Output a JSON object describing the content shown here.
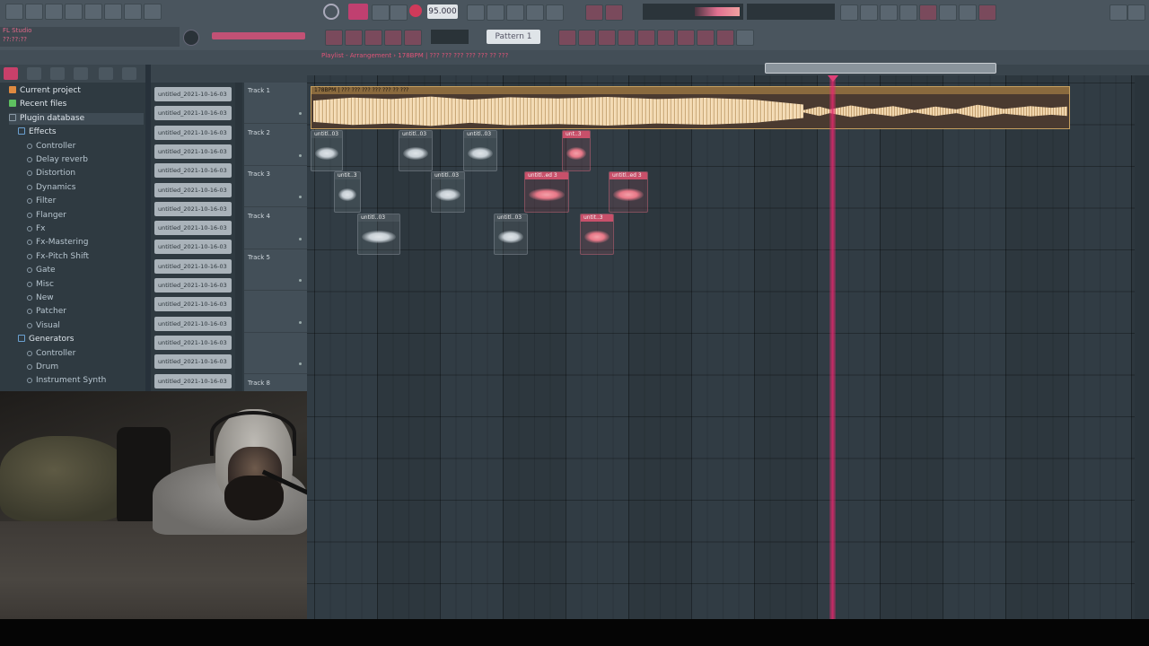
{
  "app": {
    "name": "FL Studio",
    "time": "??:??:??"
  },
  "toolbar": {
    "tempo": "95.000",
    "pattern": "Pattern 1"
  },
  "playlist": {
    "title": "Playlist - Arrangement › 178BPM | ??? ??? ??? ??? ??? ?? ???"
  },
  "browser": {
    "items": [
      {
        "label": "Current project",
        "icon": "folder-icon",
        "level": 0
      },
      {
        "label": "Recent files",
        "icon": "folder-icon",
        "level": 0
      },
      {
        "label": "Plugin database",
        "icon": "database-icon",
        "level": 0
      },
      {
        "label": "Effects",
        "icon": "folder-icon",
        "level": 1
      },
      {
        "label": "Controller",
        "icon": "plugin-icon",
        "level": 2
      },
      {
        "label": "Delay reverb",
        "icon": "plugin-icon",
        "level": 2
      },
      {
        "label": "Distortion",
        "icon": "plugin-icon",
        "level": 2
      },
      {
        "label": "Dynamics",
        "icon": "plugin-icon",
        "level": 2
      },
      {
        "label": "Filter",
        "icon": "plugin-icon",
        "level": 2
      },
      {
        "label": "Flanger",
        "icon": "plugin-icon",
        "level": 2
      },
      {
        "label": "Fx",
        "icon": "plugin-icon",
        "level": 2
      },
      {
        "label": "Fx-Mastering",
        "icon": "plugin-icon",
        "level": 2
      },
      {
        "label": "Fx-Pitch Shift",
        "icon": "plugin-icon",
        "level": 2
      },
      {
        "label": "Gate",
        "icon": "plugin-icon",
        "level": 2
      },
      {
        "label": "Misc",
        "icon": "plugin-icon",
        "level": 2
      },
      {
        "label": "New",
        "icon": "plugin-icon",
        "level": 2
      },
      {
        "label": "Patcher",
        "icon": "plugin-icon",
        "level": 2
      },
      {
        "label": "Visual",
        "icon": "plugin-icon",
        "level": 2
      },
      {
        "label": "Generators",
        "icon": "folder-icon",
        "level": 1
      },
      {
        "label": "Controller",
        "icon": "plugin-icon",
        "level": 2
      },
      {
        "label": "Drum",
        "icon": "plugin-icon",
        "level": 2
      },
      {
        "label": "Instrument Synth",
        "icon": "plugin-icon",
        "level": 2
      }
    ]
  },
  "picker": {
    "items": [
      "untitled_2021-10-16-03",
      "untitled_2021-10-16-03",
      "untitled_2021-10-16-03",
      "untitled_2021-10-16-03",
      "untitled_2021-10-16-03",
      "untitled_2021-10-16-03",
      "untitled_2021-10-16-03",
      "untitled_2021-10-16-03",
      "untitled_2021-10-16-03",
      "untitled_2021-10-16-03",
      "untitled_2021-10-16-03",
      "untitled_2021-10-16-03",
      "untitled_2021-10-16-03",
      "untitled_2021-10-16-03",
      "untitled_2021-10-16-03",
      "untitled_2021-10-16-03"
    ]
  },
  "tracks": [
    {
      "name": "Track 1"
    },
    {
      "name": "Track 2"
    },
    {
      "name": "Track 3"
    },
    {
      "name": "Track 4"
    },
    {
      "name": "Track 5"
    },
    {
      "name": ""
    },
    {
      "name": ""
    },
    {
      "name": "Track 8"
    }
  ],
  "clips": {
    "main": {
      "label": "178BPM | ??? ??? ??? ??? ??? ?? ???",
      "color": "#c6a060"
    },
    "samples": [
      {
        "label": "untitl..03",
        "color": "grey"
      },
      {
        "label": "untitl..03",
        "color": "grey"
      },
      {
        "label": "untitl..03",
        "color": "grey"
      },
      {
        "label": "unt..3",
        "color": "pink"
      },
      {
        "label": "untit..3",
        "color": "grey"
      },
      {
        "label": "untitl..03",
        "color": "grey"
      },
      {
        "label": "untitl..ed 3",
        "color": "pink"
      },
      {
        "label": "untitl..ed 3",
        "color": "pink"
      },
      {
        "label": "untitl..03",
        "color": "grey"
      },
      {
        "label": "untitl..03",
        "color": "grey"
      },
      {
        "label": "untit..3",
        "color": "pink"
      }
    ]
  },
  "colors": {
    "accent": "#e04078",
    "background": "#3a454d",
    "grid": "#313c44"
  }
}
